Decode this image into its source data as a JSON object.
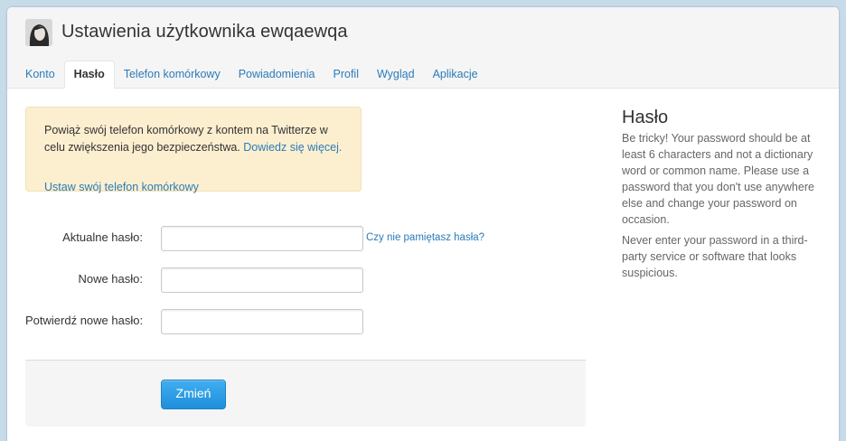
{
  "header": {
    "title": "Ustawienia użytkownika ewqaewqa"
  },
  "tabs": [
    {
      "label": "Konto",
      "active": false
    },
    {
      "label": "Hasło",
      "active": true
    },
    {
      "label": "Telefon komórkowy",
      "active": false
    },
    {
      "label": "Powiadomienia",
      "active": false
    },
    {
      "label": "Profil",
      "active": false
    },
    {
      "label": "Wygląd",
      "active": false
    },
    {
      "label": "Aplikacje",
      "active": false
    }
  ],
  "notice": {
    "text": "Powiąż swój telefon komórkowy z kontem na Twitterze w celu zwiększenia jego bezpieczeństwa.",
    "learn_more": "Dowiedz się więcej.",
    "cta": "Ustaw swój telefon komórkowy"
  },
  "form": {
    "current_password": {
      "label": "Aktualne hasło:",
      "value": ""
    },
    "forgot_link": "Czy nie pamiętasz hasła?",
    "new_password": {
      "label": "Nowe hasło:",
      "value": ""
    },
    "confirm_password": {
      "label": "Potwierdź nowe hasło:",
      "value": ""
    },
    "submit_label": "Zmień"
  },
  "sidebar": {
    "title": "Hasło",
    "paragraph1": "Be tricky! Your password should be at least 6 characters and not a dictionary word or common name. Please use a password that you don't use anywhere else and change your password on occasion.",
    "paragraph2": "Never enter your password in a third-party service or software that looks suspicious."
  },
  "colors": {
    "link": "#2b7bb9",
    "notice_bg": "#fcefd0",
    "button": "#2591dc",
    "page_bg": "#c7dbe8"
  }
}
